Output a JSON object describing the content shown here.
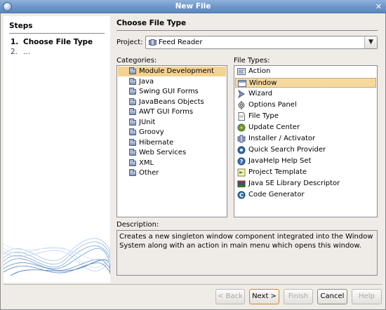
{
  "window": {
    "title": "New File"
  },
  "steps": {
    "title": "Steps",
    "items": [
      {
        "num": "1.",
        "label": "Choose File Type"
      },
      {
        "num": "2.",
        "label": "..."
      }
    ]
  },
  "main": {
    "title": "Choose File Type"
  },
  "project": {
    "label": "Project:",
    "value": "Feed Reader"
  },
  "categories": {
    "label": "Categories:",
    "items": [
      "Module Development",
      "Java",
      "Swing GUI Forms",
      "JavaBeans Objects",
      "AWT GUI Forms",
      "JUnit",
      "Groovy",
      "Hibernate",
      "Web Services",
      "XML",
      "Other"
    ],
    "selected": "Module Development"
  },
  "file_types": {
    "label": "File Types:",
    "items": [
      {
        "label": "Action",
        "icon": "action-icon"
      },
      {
        "label": "Window",
        "icon": "window-icon"
      },
      {
        "label": "Wizard",
        "icon": "wizard-icon"
      },
      {
        "label": "Options Panel",
        "icon": "options-panel-icon"
      },
      {
        "label": "File Type",
        "icon": "file-type-icon"
      },
      {
        "label": "Update Center",
        "icon": "update-center-icon"
      },
      {
        "label": "Installer / Activator",
        "icon": "installer-icon"
      },
      {
        "label": "Quick Search Provider",
        "icon": "quick-search-icon"
      },
      {
        "label": "JavaHelp Help Set",
        "icon": "help-icon"
      },
      {
        "label": "Project Template",
        "icon": "project-template-icon"
      },
      {
        "label": "Java SE Library Descriptor",
        "icon": "library-icon"
      },
      {
        "label": "Code Generator",
        "icon": "code-generator-icon"
      }
    ],
    "selected": "Window"
  },
  "description": {
    "label": "Description:",
    "text": "Creates a new singleton window component integrated into the Window System along with an action in main menu which opens this window."
  },
  "buttons": {
    "back": "< Back",
    "next": "Next >",
    "finish": "Finish",
    "cancel": "Cancel",
    "help": "Help"
  },
  "colors": {
    "selection": "#f5d28f",
    "titlebar": "#6f98c9",
    "dialog_bg": "#efebe7",
    "default_button_border": "#d2872b"
  }
}
